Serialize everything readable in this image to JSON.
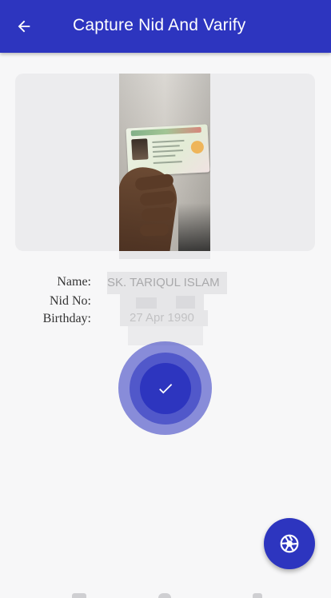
{
  "app_bar": {
    "title": "Capture Nid And Varify",
    "back_icon": "arrow-left-icon",
    "background": "#2d35bf"
  },
  "info": {
    "name_label": "Name:",
    "name_value": "SK. TARIQUL ISLAM",
    "nid_label": "Nid No:",
    "nid_value": "",
    "birthday_label": "Birthday:",
    "birthday_value": "27 Apr 1990"
  },
  "actions": {
    "verify_icon": "check-icon",
    "capture_icon": "camera-shutter-icon"
  },
  "colors": {
    "accent": "#2d35bf",
    "page_bg": "#f7f7f8",
    "card_bg": "#ececee"
  }
}
